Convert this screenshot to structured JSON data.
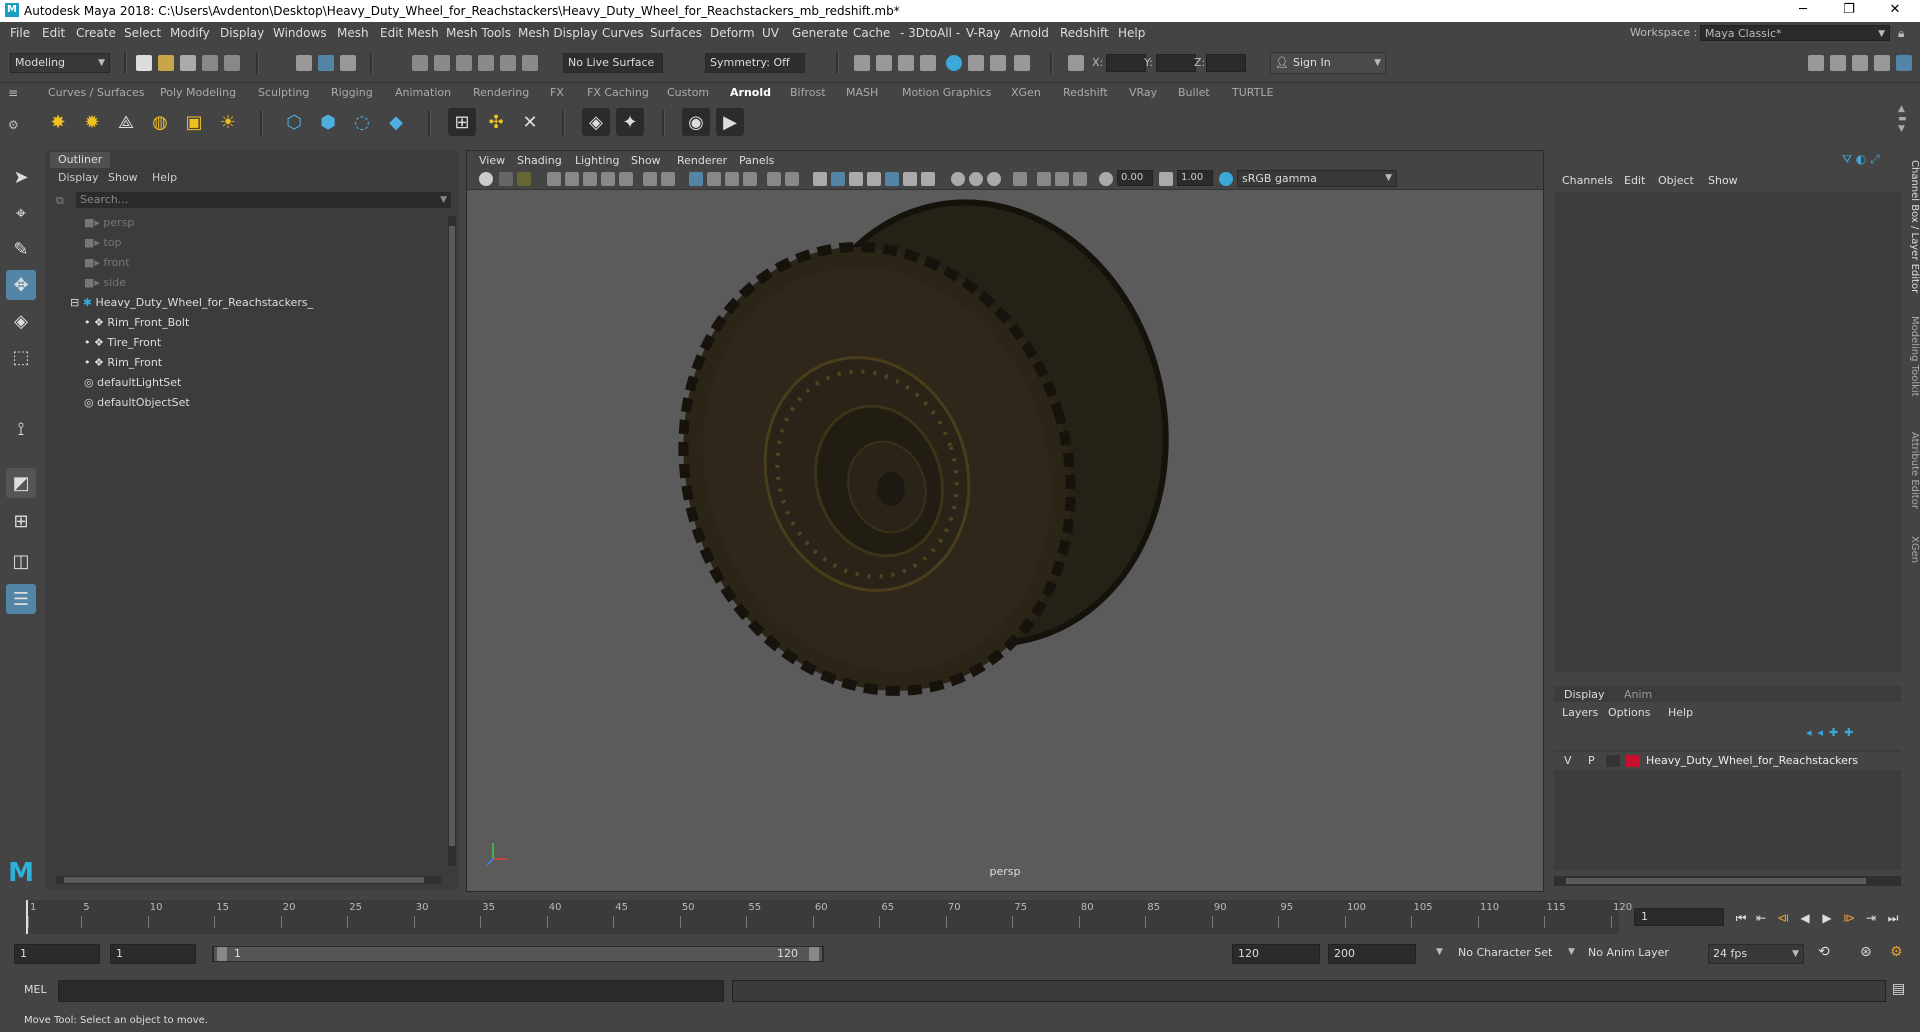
{
  "window": {
    "title": "Autodesk Maya 2018: C:\\Users\\Avdenton\\Desktop\\Heavy_Duty_Wheel_for_Reachstackers\\Heavy_Duty_Wheel_for_Reachstackers_mb_redshift.mb*",
    "logo_letter": "M",
    "minimize": "─",
    "maximize": "❐",
    "close": "✕"
  },
  "menubar": {
    "items": [
      "File",
      "Edit",
      "Create",
      "Select",
      "Modify",
      "Display",
      "Windows",
      "Mesh",
      "Edit Mesh",
      "Mesh Tools",
      "Mesh Display",
      "Curves",
      "Surfaces",
      "Deform",
      "UV",
      "Generate",
      "Cache",
      "- 3DtoAll -",
      "V-Ray",
      "Arnold",
      "Redshift",
      "Help"
    ],
    "workspace_label": "Workspace :",
    "workspace_value": "Maya Classic*"
  },
  "statusline": {
    "mode": "Modeling",
    "live_surface": "No Live Surface",
    "symmetry": "Symmetry: Off",
    "x_label": "X:",
    "y_label": "Y:",
    "z_label": "Z:",
    "sign_in": "Sign In"
  },
  "shelf": {
    "tabs": [
      "Curves / Surfaces",
      "Poly Modeling",
      "Sculpting",
      "Rigging",
      "Animation",
      "Rendering",
      "FX",
      "FX Caching",
      "Custom",
      "Arnold",
      "Bifrost",
      "MASH",
      "Motion Graphics",
      "XGen",
      "Redshift",
      "VRay",
      "Bullet",
      "TURTLE"
    ],
    "active_tab": "Arnold"
  },
  "outliner": {
    "title": "Outliner",
    "menu": [
      "Display",
      "Show",
      "Help"
    ],
    "search_placeholder": "Search...",
    "items": [
      {
        "label": "persp",
        "type": "camera",
        "dim": true
      },
      {
        "label": "top",
        "type": "camera",
        "dim": true
      },
      {
        "label": "front",
        "type": "camera",
        "dim": true
      },
      {
        "label": "side",
        "type": "camera",
        "dim": true
      },
      {
        "label": "Heavy_Duty_Wheel_for_Reachstackers_",
        "type": "group",
        "dim": false
      },
      {
        "label": "Rim_Front_Bolt",
        "type": "mesh",
        "dim": false
      },
      {
        "label": "Tire_Front",
        "type": "mesh",
        "dim": false
      },
      {
        "label": "Rim_Front",
        "type": "mesh",
        "dim": false
      },
      {
        "label": "defaultLightSet",
        "type": "set",
        "dim": false
      },
      {
        "label": "defaultObjectSet",
        "type": "set",
        "dim": false
      }
    ],
    "collapse_symbol": "⊟",
    "dot_symbol": "•"
  },
  "viewport": {
    "menu": [
      "View",
      "Shading",
      "Lighting",
      "Show",
      "Renderer",
      "Panels"
    ],
    "exposure": "0.00",
    "gamma": "1.00",
    "color_space": "sRGB gamma",
    "camera_label": "persp"
  },
  "channelbox": {
    "menu": [
      "Channels",
      "Edit",
      "Object",
      "Show"
    ]
  },
  "layers": {
    "tabs": [
      "Display",
      "Anim"
    ],
    "menu": [
      "Layers",
      "Options",
      "Help"
    ],
    "row": {
      "v": "V",
      "p": "P",
      "name": "Heavy_Duty_Wheel_for_Reachstackers",
      "color": "#c8102e"
    }
  },
  "side_tabs": [
    "Channel Box / Layer Editor",
    "Modeling Toolkit",
    "Attribute Editor",
    "XGen"
  ],
  "timeline": {
    "ticks": [
      "1",
      "5",
      "10",
      "15",
      "20",
      "25",
      "30",
      "35",
      "40",
      "45",
      "50",
      "55",
      "60",
      "65",
      "70",
      "75",
      "80",
      "85",
      "90",
      "95",
      "100",
      "105",
      "110",
      "115",
      "120"
    ],
    "current_frame": "1"
  },
  "range": {
    "start": "1",
    "playback_start": "1",
    "slider_start": "1",
    "slider_end": "120",
    "playback_end": "120",
    "end": "200",
    "character_set": "No Character Set",
    "anim_layer": "No Anim Layer",
    "fps": "24 fps"
  },
  "mel": {
    "label": "MEL"
  },
  "help_line": "Move Tool: Select an object to move.",
  "colors": {
    "accent": "#5285a6",
    "panel_bg": "#444444",
    "viewport_bg": "#5b5b5b"
  }
}
